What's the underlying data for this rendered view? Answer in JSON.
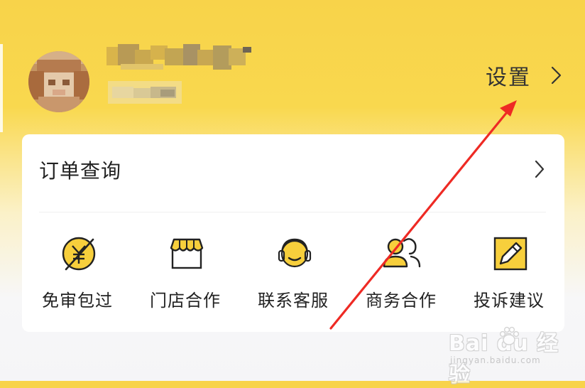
{
  "profile": {
    "avatar_icon": "avatar",
    "name_state": "blurred",
    "subtitle_state": "blurred"
  },
  "header": {
    "settings_label": "设置",
    "settings_chevron_icon": "chevron-right-icon"
  },
  "card": {
    "order_label": "订单查询",
    "order_chevron_icon": "chevron-right-icon",
    "actions": [
      {
        "label": "免审包过",
        "icon": "yuan-slash-icon"
      },
      {
        "label": "门店合作",
        "icon": "store-icon"
      },
      {
        "label": "联系客服",
        "icon": "headset-icon"
      },
      {
        "label": "商务合作",
        "icon": "people-icon"
      },
      {
        "label": "投诉建议",
        "icon": "pencil-square-icon"
      }
    ]
  },
  "colors": {
    "accent": "#F8D34A",
    "icon_fill": "#F7CF3C",
    "icon_stroke": "#222222",
    "annotation_arrow": "#EE2A24",
    "text": "#222222"
  },
  "watermark": {
    "main": "Bai  du 经验",
    "sub": "jingyan.baidu.com"
  }
}
